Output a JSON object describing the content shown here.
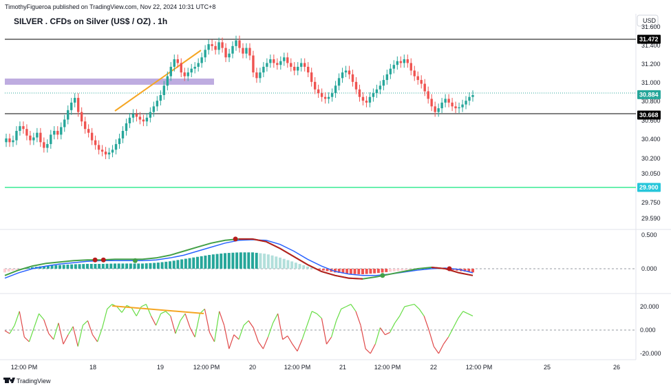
{
  "header": {
    "published_line": "TimothyFigueroa published on TradingView.com, Nov 22, 2024 10:31 UTC+8",
    "symbol_title": "SILVER . CFDs on Silver (US$ / OZ) . 1h",
    "currency_button": "USD"
  },
  "footer": {
    "brand": "TradingView"
  },
  "colors": {
    "up": "#26a69a",
    "down": "#ef5350",
    "macd_fast": "#43a047",
    "macd_signal": "#2962ff",
    "macd_cross_down": "#b71c1c",
    "rsi_up": "#66dd44",
    "rsi_down": "#e04848",
    "zone": "#b39ddb",
    "trend": "#f5a623",
    "support": "#69f0ae",
    "last_price_tag": "#26a69a",
    "level_tag": "#000000",
    "support_tag": "#26c6da"
  },
  "price_axis": {
    "ticks": [
      "31.600",
      "31.400",
      "31.200",
      "31.000",
      "30.800",
      "30.600",
      "30.400",
      "30.200",
      "30.050",
      "29.900",
      "29.750",
      "29.590"
    ],
    "tags": [
      {
        "label": "31.472",
        "value": 31.472,
        "kind": "level"
      },
      {
        "label": "30.884",
        "value": 30.884,
        "kind": "last"
      },
      {
        "label": "30.668",
        "value": 30.668,
        "kind": "level"
      },
      {
        "label": "29.900",
        "value": 29.9,
        "kind": "support"
      }
    ]
  },
  "macd_axis": {
    "ticks": [
      "0.500",
      "0.000"
    ]
  },
  "rsi_axis": {
    "ticks": [
      "20.000",
      "0.000",
      "-20.000"
    ]
  },
  "time_axis": {
    "ticks": [
      "12:00 PM",
      "18",
      "19",
      "12:00 PM",
      "20",
      "12:00 PM",
      "21",
      "12:00 PM",
      "22",
      "12:00 PM",
      "25",
      "26"
    ]
  },
  "chart_data": [
    {
      "type": "candlestick",
      "title": "SILVER . CFDs on Silver (US$ / OZ) . 1h",
      "ylim": [
        29.59,
        31.6
      ],
      "x_dates": [
        "Nov 17 12:00 PM",
        "Nov 18",
        "Nov 19",
        "Nov 19 12:00 PM",
        "Nov 20",
        "Nov 20 12:00 PM",
        "Nov 21",
        "Nov 21 12:00 PM",
        "Nov 22",
        "Nov 22 12:00 PM",
        "Nov 25",
        "Nov 26"
      ],
      "close": [
        30.42,
        30.38,
        30.4,
        30.5,
        30.55,
        30.52,
        30.45,
        30.4,
        30.43,
        30.48,
        30.38,
        30.32,
        30.36,
        30.46,
        30.5,
        30.46,
        30.54,
        30.62,
        30.72,
        30.8,
        30.85,
        30.7,
        30.6,
        30.52,
        30.48,
        30.4,
        30.35,
        30.3,
        30.28,
        30.25,
        30.27,
        30.3,
        30.36,
        30.42,
        30.5,
        30.58,
        30.64,
        30.68,
        30.65,
        30.62,
        30.6,
        30.64,
        30.7,
        30.76,
        30.82,
        30.88,
        30.98,
        31.08,
        31.18,
        31.26,
        31.22,
        31.12,
        31.08,
        31.12,
        31.16,
        31.18,
        31.22,
        31.28,
        31.36,
        31.42,
        31.4,
        31.36,
        31.44,
        31.38,
        31.28,
        31.32,
        31.4,
        31.46,
        31.38,
        31.32,
        31.38,
        31.3,
        31.12,
        31.06,
        31.12,
        31.18,
        31.22,
        31.26,
        31.22,
        31.2,
        31.24,
        31.28,
        31.22,
        31.18,
        31.14,
        31.18,
        31.22,
        31.18,
        31.12,
        31.02,
        30.94,
        30.9,
        30.86,
        30.84,
        30.86,
        30.9,
        30.98,
        31.06,
        31.12,
        31.14,
        31.1,
        31.02,
        30.94,
        30.86,
        30.82,
        30.8,
        30.86,
        30.9,
        30.94,
        30.98,
        31.04,
        31.1,
        31.16,
        31.2,
        31.24,
        31.22,
        31.26,
        31.22,
        31.14,
        31.08,
        31.04,
        31.0,
        30.92,
        30.84,
        30.76,
        30.7,
        30.74,
        30.8,
        30.84,
        30.8,
        30.76,
        30.74,
        30.75,
        30.78,
        30.82,
        30.86,
        30.88
      ],
      "annotations": [
        "31.472 horizontal level",
        "30.668 horizontal level",
        "29.900 support line",
        "supply zone ~31.00",
        "trend line"
      ]
    },
    {
      "type": "line",
      "series": [
        {
          "values": [
            -0.1,
            -0.02,
            0.04,
            0.08,
            0.1,
            0.12,
            0.13,
            0.13,
            0.14,
            0.14,
            0.14,
            0.16,
            0.2,
            0.26,
            0.32,
            0.38,
            0.42,
            0.44,
            0.44,
            0.4,
            0.3,
            0.18,
            0.06,
            -0.04,
            -0.1,
            -0.14,
            -0.15,
            -0.12,
            -0.08,
            -0.04,
            0.0,
            0.02,
            0.0,
            -0.06,
            -0.1
          ]
        },
        {
          "values": [
            -0.14,
            -0.06,
            0.0,
            0.04,
            0.07,
            0.09,
            0.11,
            0.12,
            0.12,
            0.12,
            0.12,
            0.13,
            0.16,
            0.2,
            0.26,
            0.32,
            0.38,
            0.42,
            0.43,
            0.42,
            0.36,
            0.26,
            0.14,
            0.04,
            -0.04,
            -0.08,
            -0.1,
            -0.1,
            -0.08,
            -0.05,
            -0.02,
            0.0,
            0.01,
            -0.01,
            -0.06
          ]
        }
      ],
      "ylim": [
        -0.3,
        0.55
      ]
    },
    {
      "type": "line",
      "series": [
        {
          "values": [
            -0.5,
            -3,
            4,
            16,
            -6,
            -10,
            2,
            14,
            9,
            -3,
            -8,
            6,
            -12,
            -4,
            3,
            -14,
            4,
            8,
            -4,
            -10,
            2,
            18,
            22,
            20,
            15,
            21,
            19,
            12,
            20,
            22,
            12,
            4,
            14,
            16,
            12,
            -3,
            8,
            14,
            2,
            -6,
            14,
            18,
            -2,
            -10,
            16,
            4,
            -16,
            -4,
            -8,
            4,
            8,
            2,
            -10,
            -16,
            -6,
            6,
            14,
            -8,
            -5,
            -12,
            -18,
            -8,
            4,
            16,
            14,
            10,
            -12,
            -6,
            8,
            18,
            20,
            22,
            16,
            4,
            -16,
            -20,
            -12,
            2,
            -4,
            -2,
            6,
            12,
            20,
            21,
            22,
            18,
            12,
            0,
            -14,
            -20,
            -12,
            -6,
            2,
            10,
            16,
            14,
            12
          ]
        }
      ],
      "ylim": [
        -24,
        24
      ]
    }
  ]
}
